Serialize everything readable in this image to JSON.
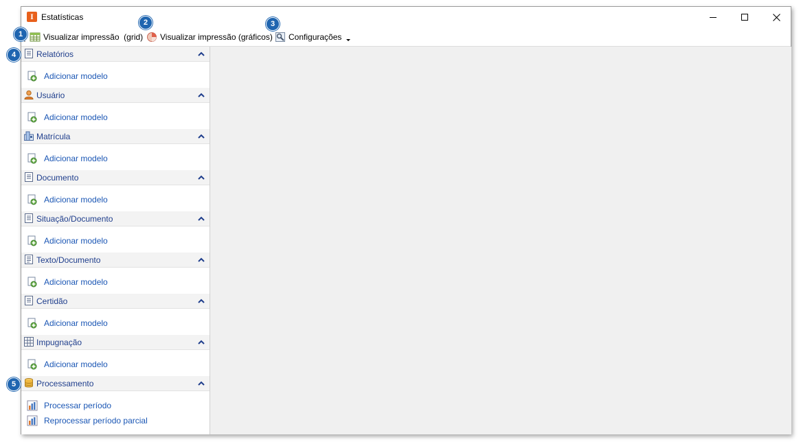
{
  "window": {
    "title": "Estatísticas",
    "app_icon_letter": "I"
  },
  "toolbar": {
    "items": [
      {
        "label": "Visualizar impressão  (grid)",
        "icon": "grid-view-icon"
      },
      {
        "label": "Visualizar impressão (gráficos)",
        "icon": "pie-chart-icon"
      },
      {
        "label": "Configurações",
        "icon": "settings-icon"
      }
    ]
  },
  "sidebar": {
    "groups": [
      {
        "title": "Relatórios",
        "icon": "document-icon",
        "items": [
          "Adicionar modelo"
        ]
      },
      {
        "title": "Usuário",
        "icon": "user-icon",
        "items": [
          "Adicionar modelo"
        ]
      },
      {
        "title": "Matrícula",
        "icon": "building-icon",
        "items": [
          "Adicionar modelo"
        ]
      },
      {
        "title": "Documento",
        "icon": "document-icon",
        "items": [
          "Adicionar modelo"
        ]
      },
      {
        "title": "Situação/Documento",
        "icon": "document-icon",
        "items": [
          "Adicionar modelo"
        ]
      },
      {
        "title": "Texto/Documento",
        "icon": "text-document-icon",
        "items": [
          "Adicionar modelo"
        ]
      },
      {
        "title": "Certidão",
        "icon": "document-icon",
        "items": [
          "Adicionar modelo"
        ]
      },
      {
        "title": "Impugnação",
        "icon": "grid-document-icon",
        "items": [
          "Adicionar modelo"
        ]
      },
      {
        "title": "Processamento",
        "icon": "database-icon",
        "items": [
          "Processar período",
          "Reprocessar período parcial"
        ]
      }
    ]
  },
  "callouts": [
    "1",
    "2",
    "3",
    "4",
    "5"
  ],
  "colors": {
    "header_text": "#1f3e8c",
    "link_text": "#1a56b4",
    "badge": "#1f65b0",
    "content_bg": "#f0f0f0"
  }
}
